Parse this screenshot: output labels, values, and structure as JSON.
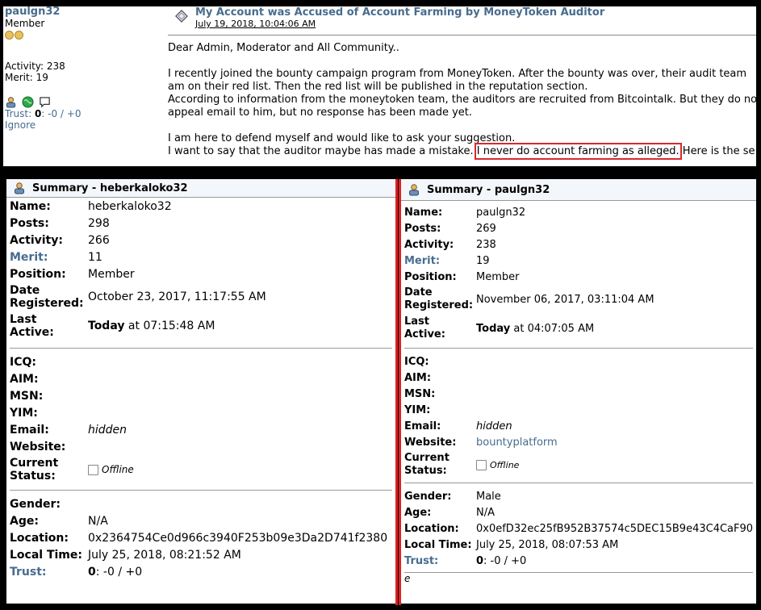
{
  "post": {
    "poster_name": "paulgn32",
    "poster_rank": "Member",
    "activity": "Activity: 238",
    "merit": "Merit: 19",
    "trust_label": "Trust:",
    "trust_value": "0",
    "trust_rest": ": -0 / +0",
    "ignore": "Ignore",
    "title": "My Account was Accused of Account Farming by MoneyToken Auditor",
    "date": "July 19, 2018, 10:04:06 AM",
    "lines": [
      "Dear Admin, Moderator and All Community..",
      "I recently joined the bounty campaign program from MoneyToken. After the bounty was over, their audit team",
      "am on their red list. Then the red list will be published in the reputation section.",
      "According to information from the moneytoken team, the auditors are recruited from Bitcointalk. But they do no",
      "appeal email to him, but no response has been made yet.",
      "I am here to defend myself and would like to ask your suggestion.",
      "I want to say that the auditor maybe has made a mistake.",
      "I never do account farming as alleged.",
      " Here is the se"
    ]
  },
  "summary_left": {
    "title": "Summary - heberkaloko32",
    "labels": {
      "name": "Name:",
      "posts": "Posts:",
      "activity": "Activity:",
      "merit": "Merit:",
      "position": "Position:",
      "date1": "Date",
      "date2": "Registered:",
      "last1": "Last",
      "last2": "Active:",
      "icq": "ICQ:",
      "aim": "AIM:",
      "msn": "MSN:",
      "yim": "YIM:",
      "email": "Email:",
      "website": "Website:",
      "status1": "Current",
      "status2": "Status:",
      "gender": "Gender:",
      "age": "Age:",
      "location": "Location:",
      "localtime": "Local Time:",
      "trust": "Trust:"
    },
    "name": "heberkaloko32",
    "posts": "298",
    "activity": "266",
    "merit": "11",
    "position": "Member",
    "registered": "October 23, 2017, 11:17:55 AM",
    "last_active_bold": "Today",
    "last_active_rest": " at 07:15:48 AM",
    "email": "hidden",
    "status": "Offline",
    "age": "N/A",
    "location": "0x2364754Ce0d966c3940F253b09e3Da2D741f2380",
    "local_time": "July 25, 2018, 08:21:52 AM",
    "trust_bold": "0",
    "trust_rest": ": -0 / +0"
  },
  "summary_right": {
    "title": "Summary - paulgn32",
    "labels": {
      "name": "Name:",
      "posts": "Posts:",
      "activity": "Activity:",
      "merit": "Merit:",
      "position": "Position:",
      "date1": "Date",
      "date2": "Registered:",
      "last1": "Last",
      "last2": "Active:",
      "icq": "ICQ:",
      "aim": "AIM:",
      "msn": "MSN:",
      "yim": "YIM:",
      "email": "Email:",
      "website": "Website:",
      "status1": "Current",
      "status2": "Status:",
      "gender": "Gender:",
      "age": "Age:",
      "location": "Location:",
      "localtime": "Local Time:",
      "trust": "Trust:"
    },
    "name": "paulgn32",
    "posts": "269",
    "activity": "238",
    "merit": "19",
    "position": "Member",
    "registered": "November 06, 2017, 03:11:04 AM",
    "last_active_bold": "Today",
    "last_active_rest": " at 04:07:05 AM",
    "email": "hidden",
    "website": "bountyplatform",
    "status": "Offline",
    "gender": "Male",
    "age": "N/A",
    "location": "0x0efD32ec25fB952B37574c5DEC15B9e43C4CaF90",
    "local_time": "July 25, 2018, 08:07:53 AM",
    "trust_bold": "0",
    "trust_rest": ": -0 / +0",
    "footer_char": "e"
  }
}
